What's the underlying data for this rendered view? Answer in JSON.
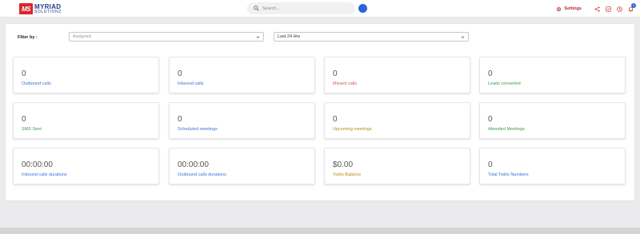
{
  "header": {
    "logo_mark": "MS",
    "logo_line1": "MYRIAD",
    "logo_line2": "SOLUTIONZ",
    "search_placeholder": "Search...",
    "settings_label": "Settings",
    "notification_count": "1",
    "icons": [
      "search-icon",
      "gear-icon",
      "share-icon",
      "checklist-icon",
      "clock-icon",
      "bell-icon"
    ],
    "accent_color": "#c0272d",
    "avatar_color": "#2b63d9"
  },
  "filters": {
    "label": "Filter by :",
    "assigned_placeholder": "Assigned",
    "time_range": "Last 24 Hrs"
  },
  "cards": [
    {
      "value": "0",
      "label": "Outbound calls",
      "color": "#3b73d6"
    },
    {
      "value": "0",
      "label": "Inbound calls",
      "color": "#3b73d6"
    },
    {
      "value": "0",
      "label": "Missed calls",
      "color": "#e0564a"
    },
    {
      "value": "0",
      "label": "Leads converted",
      "color": "#3f9a4a"
    },
    {
      "value": "0",
      "label": "SMS Sent",
      "color": "#3f9a4a"
    },
    {
      "value": "0",
      "label": "Scheduled meetings",
      "color": "#3b73d6"
    },
    {
      "value": "0",
      "label": "Upcoming meetings",
      "color": "#b88a1e"
    },
    {
      "value": "0",
      "label": "Attended Meetings",
      "color": "#3f9a4a"
    },
    {
      "value": "00:00:00",
      "label": "Inbound calls durations",
      "color": "#3b73d6"
    },
    {
      "value": "00:00:00",
      "label": "Outbound calls durations",
      "color": "#3b73d6"
    },
    {
      "value": "$0.00",
      "label": "Twilio Balance",
      "color": "#b88a1e"
    },
    {
      "value": "0",
      "label": "Total Twilio Numbers",
      "color": "#3b73d6"
    }
  ]
}
